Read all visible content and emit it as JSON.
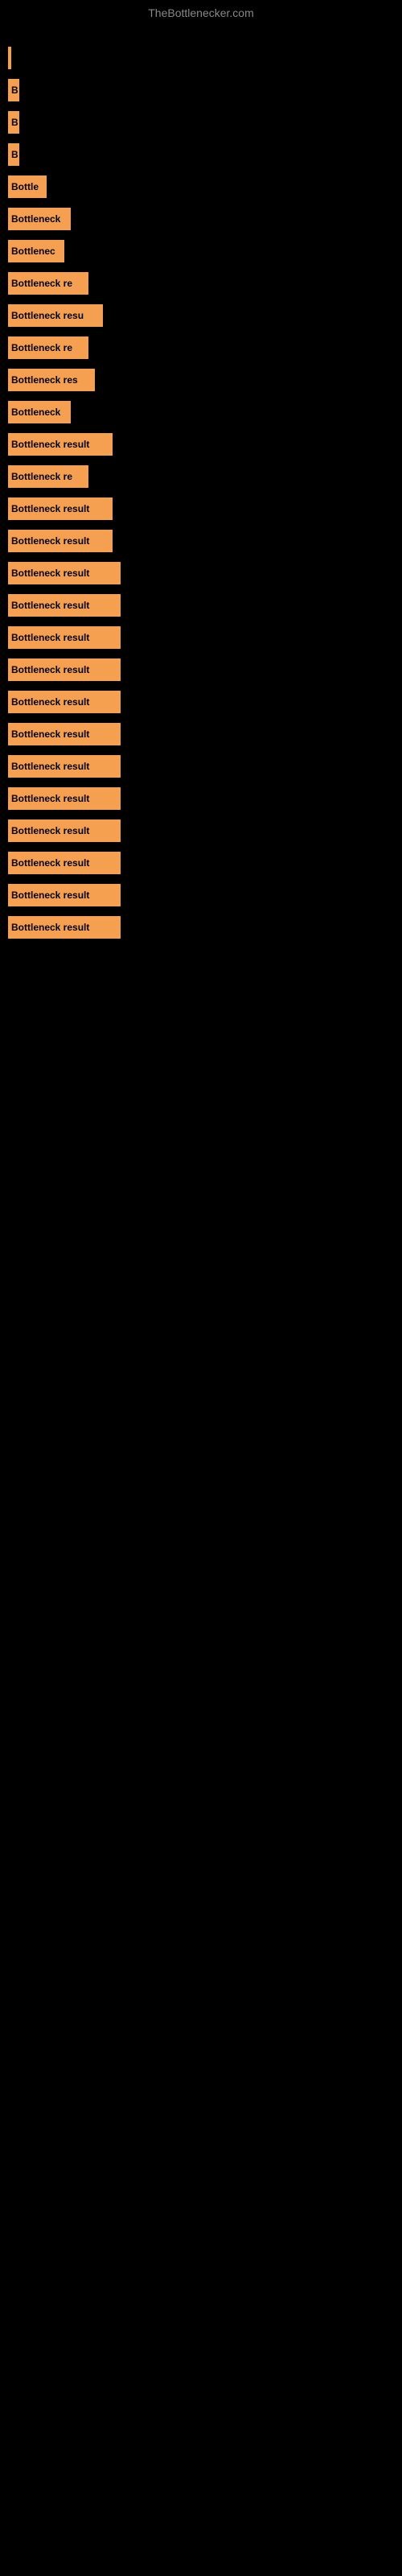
{
  "site": {
    "title": "TheBottlenecker.com"
  },
  "bars": [
    {
      "label": "",
      "width": 4
    },
    {
      "label": "B",
      "width": 14
    },
    {
      "label": "B",
      "width": 14
    },
    {
      "label": "B",
      "width": 14
    },
    {
      "label": "Bottle",
      "width": 48
    },
    {
      "label": "Bottleneck",
      "width": 78
    },
    {
      "label": "Bottlenec",
      "width": 70
    },
    {
      "label": "Bottleneck re",
      "width": 100
    },
    {
      "label": "Bottleneck resu",
      "width": 118
    },
    {
      "label": "Bottleneck re",
      "width": 100
    },
    {
      "label": "Bottleneck res",
      "width": 108
    },
    {
      "label": "Bottleneck",
      "width": 78
    },
    {
      "label": "Bottleneck result",
      "width": 130
    },
    {
      "label": "Bottleneck re",
      "width": 100
    },
    {
      "label": "Bottleneck result",
      "width": 130
    },
    {
      "label": "Bottleneck result",
      "width": 130
    },
    {
      "label": "Bottleneck result",
      "width": 140
    },
    {
      "label": "Bottleneck result",
      "width": 140
    },
    {
      "label": "Bottleneck result",
      "width": 140
    },
    {
      "label": "Bottleneck result",
      "width": 140
    },
    {
      "label": "Bottleneck result",
      "width": 140
    },
    {
      "label": "Bottleneck result",
      "width": 140
    },
    {
      "label": "Bottleneck result",
      "width": 140
    },
    {
      "label": "Bottleneck result",
      "width": 140
    },
    {
      "label": "Bottleneck result",
      "width": 140
    },
    {
      "label": "Bottleneck result",
      "width": 140
    },
    {
      "label": "Bottleneck result",
      "width": 140
    },
    {
      "label": "Bottleneck result",
      "width": 140
    }
  ]
}
